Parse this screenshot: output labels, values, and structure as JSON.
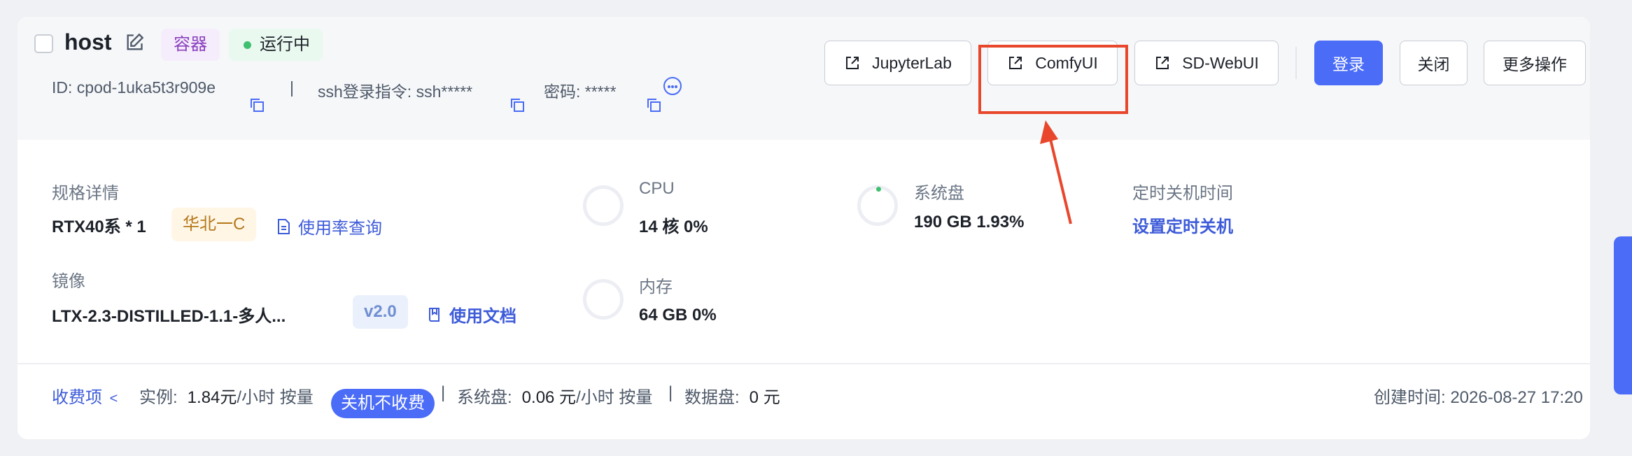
{
  "header": {
    "title": "host",
    "tags": {
      "container": "容器",
      "status": "运行中"
    },
    "meta": {
      "id": "ID: cpod-1uka5t3r909e",
      "sep": "|",
      "ssh": "ssh登录指令: ssh*****",
      "password": "密码: *****"
    },
    "buttons": {
      "jupyterlab": "JupyterLab",
      "comfyui": "ComfyUI",
      "sdwebui": "SD-WebUI",
      "login": "登录",
      "close": "关闭",
      "more": "更多操作"
    }
  },
  "specs": {
    "label": "规格详情",
    "gpu": "RTX40系 * 1",
    "region": "华北一C",
    "usage_link": "使用率查询",
    "image_label": "镜像",
    "image_name": "LTX-2.3-DISTILLED-1.1-多人...",
    "image_version": "v2.0",
    "docs_link": "使用文档"
  },
  "resources": {
    "cpu_label": "CPU",
    "cpu_value": "14 核 0%",
    "mem_label": "内存",
    "mem_value": "64 GB 0%",
    "disk_label": "系统盘",
    "disk_value": "190 GB 1.93%",
    "shutdown_label": "定时关机时间",
    "shutdown_link": "设置定时关机"
  },
  "footer": {
    "fees_link": "收费项",
    "fees_chevron": "<",
    "instance_label": "实例:",
    "instance_price": "1.84元",
    "instance_unit": "/小时 按量",
    "off_badge": "关机不收费",
    "sep": "|",
    "disk_label": "系统盘:",
    "disk_price": "0.06 元",
    "disk_unit": "/小时 按量",
    "data_label": "数据盘:",
    "data_price": "0 元",
    "created": "创建时间: 2026-08-27 17:20"
  },
  "colors": {
    "primary": "#4a6cf7",
    "highlight": "#e8472c",
    "running": "#3fbf6f"
  }
}
